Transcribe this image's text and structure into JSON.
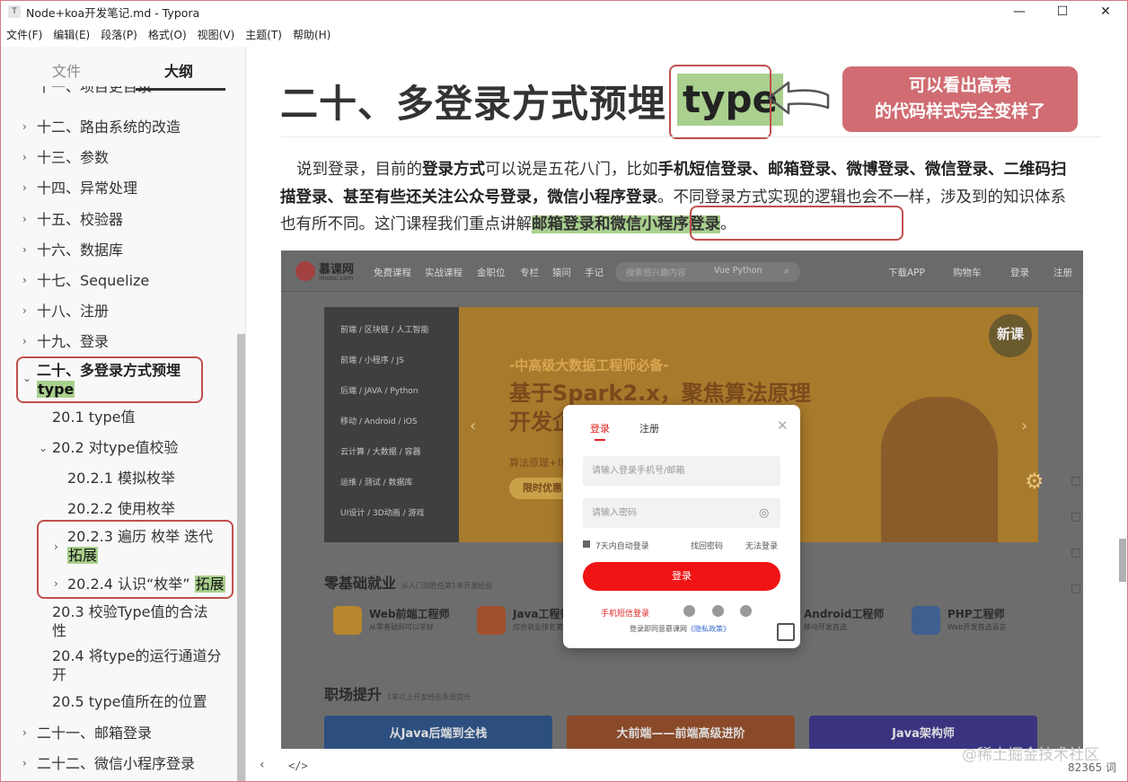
{
  "window": {
    "icon": "T",
    "title": "Node+koa开发笔记.md - Typora",
    "controls": {
      "minimize": "—",
      "maximize": "☐",
      "close": "✕"
    }
  },
  "menu": [
    "文件(F)",
    "编辑(E)",
    "段落(P)",
    "格式(O)",
    "视图(V)",
    "主题(T)",
    "帮助(H)"
  ],
  "sidebar": {
    "tabs": {
      "files": "文件",
      "outline": "大纲"
    },
    "outline": [
      {
        "label": "十一、项目更目录",
        "partial": true
      },
      {
        "label": "十二、路由系统的改造"
      },
      {
        "label": "十三、参数"
      },
      {
        "label": "十四、异常处理"
      },
      {
        "label": "十五、校验器"
      },
      {
        "label": "十六、数据库"
      },
      {
        "label": "十七、Sequelize"
      },
      {
        "label": "十八、注册"
      },
      {
        "label": "十九、登录"
      },
      {
        "label": "二十、多登录方式预埋",
        "highlight": "type"
      },
      {
        "label": "20.1 type值"
      },
      {
        "label": "20.2 对type值校验"
      },
      {
        "label": "20.2.1 模拟枚举"
      },
      {
        "label": "20.2.2 使用枚举"
      },
      {
        "label": "20.2.3 遍历 枚举 迭代",
        "highlight": "拓展"
      },
      {
        "label": "20.2.4 认识“枚举”",
        "highlight": "拓展"
      },
      {
        "label_line1": "20.3 校验Type值的合法",
        "label_line2": "性"
      },
      {
        "label_line1": "20.4 将type的运行通道分",
        "label_line2": "开"
      },
      {
        "label": "20.5 type值所在的位置"
      },
      {
        "label": "二十一、邮箱登录"
      },
      {
        "label": "二十二、微信小程序登录"
      }
    ]
  },
  "content": {
    "heading": "二十、多登录方式预埋",
    "heading_highlight": "type",
    "annotation": {
      "line1": "可以看出高亮",
      "line2": "的代码样式完全变样了",
      "color": "#d06c72"
    },
    "paragraph": {
      "t1": "说到登录，目前的",
      "b1": "登录方式",
      "t2": "可以说是五花八门，比如",
      "b2": "手机短信登录、邮箱登录、微博登录、微信登录、二维码扫描登录、甚至有些还关注公众号登录，微信小程序登录",
      "t3": "。不同登录方式实现的逻辑也会不一样，涉及到的知识体系也有所不同。这门课程我们重点讲解",
      "b3": "邮箱登录和微信小程序登录",
      "t4": "。"
    },
    "highlight_color": "#a9d08e"
  },
  "embedded": {
    "logo": "慕课网",
    "logo_sub": "imooc.com",
    "nav": [
      "免费课程",
      "实战课程",
      "金职位",
      "专栏",
      "猿问",
      "手记"
    ],
    "search_placeholder": "搜索感兴趣内容",
    "search_tags": "Vue  Python",
    "nav_right": [
      "下载APP",
      "购物车",
      "登录",
      "注册"
    ],
    "categories": [
      "前端 / 区块链 / 人工智能",
      "前端 / 小程序 / JS",
      "后端 / JAVA / Python",
      "移动 / Android / iOS",
      "云计算 / 大数据 / 容器",
      "运维 / 测试 / 数据库",
      "UI设计 / 3D动画 / 游戏"
    ],
    "banner": {
      "sub": "-中高级大数据工程师必备-",
      "title_line1": "基于Spark2.x，聚焦算法原理",
      "title_line2": "开发企业级大数据项目",
      "small": "算法原理+场景实战",
      "button": "限时优惠",
      "badge": "新课"
    },
    "section1": {
      "title": "零基础就业",
      "sub": "从入门到胜任第1年开发经验"
    },
    "courses": [
      {
        "name": "Web前端工程师",
        "desc": "从零基础到可以学好"
      },
      {
        "name": "Java工程师",
        "desc": "综合就业排名第一"
      },
      {
        "name": "Android工程师",
        "desc": "移动开发首选"
      },
      {
        "name": "PHP工程师",
        "desc": "Web开发首选语言"
      }
    ],
    "section2": {
      "title": "职场提升",
      "sub": "1年以上开发经验系统提升"
    },
    "paths": [
      "从Java后端到全栈",
      "大前端——前端高级进阶",
      "Java架构师"
    ],
    "modal": {
      "tab_login": "登录",
      "tab_register": "注册",
      "phone_placeholder": "请输入登录手机号/邮箱",
      "password_placeholder": "请输入密码",
      "remember": "7天内自动登录",
      "forgot": "找回密码",
      "cannot_login": "无法登录",
      "login_button": "登录",
      "sms_login": "手机短信登录",
      "agree_text": "登录即同意慕课网",
      "privacy": "《隐私政策》"
    }
  },
  "status": {
    "word_count": "82365 词",
    "watermark": "@稀土掘金技术社区"
  }
}
